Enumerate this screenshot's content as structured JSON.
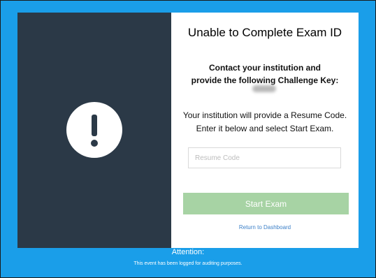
{
  "dialog": {
    "title": "Unable to Complete Exam ID",
    "contact_line1": "Contact your institution and",
    "contact_line2": "provide the following Challenge Key:",
    "resume_line1": "Your institution will provide a Resume Code.",
    "resume_line2": "Enter it below and select Start Exam.",
    "resume_input": {
      "placeholder": "Resume Code",
      "value": ""
    },
    "start_button_label": "Start Exam",
    "return_link_label": "Return to Dashboard"
  },
  "footer": {
    "attention_label": "Attention:",
    "logged_message": "This event has been logged for auditing purposes."
  },
  "icons": {
    "alert": "exclamation-circle-icon"
  },
  "colors": {
    "background": "#1a9ee9",
    "left_panel": "#2b3947",
    "start_button": "#a7d3a4",
    "link": "#3c80c8"
  }
}
